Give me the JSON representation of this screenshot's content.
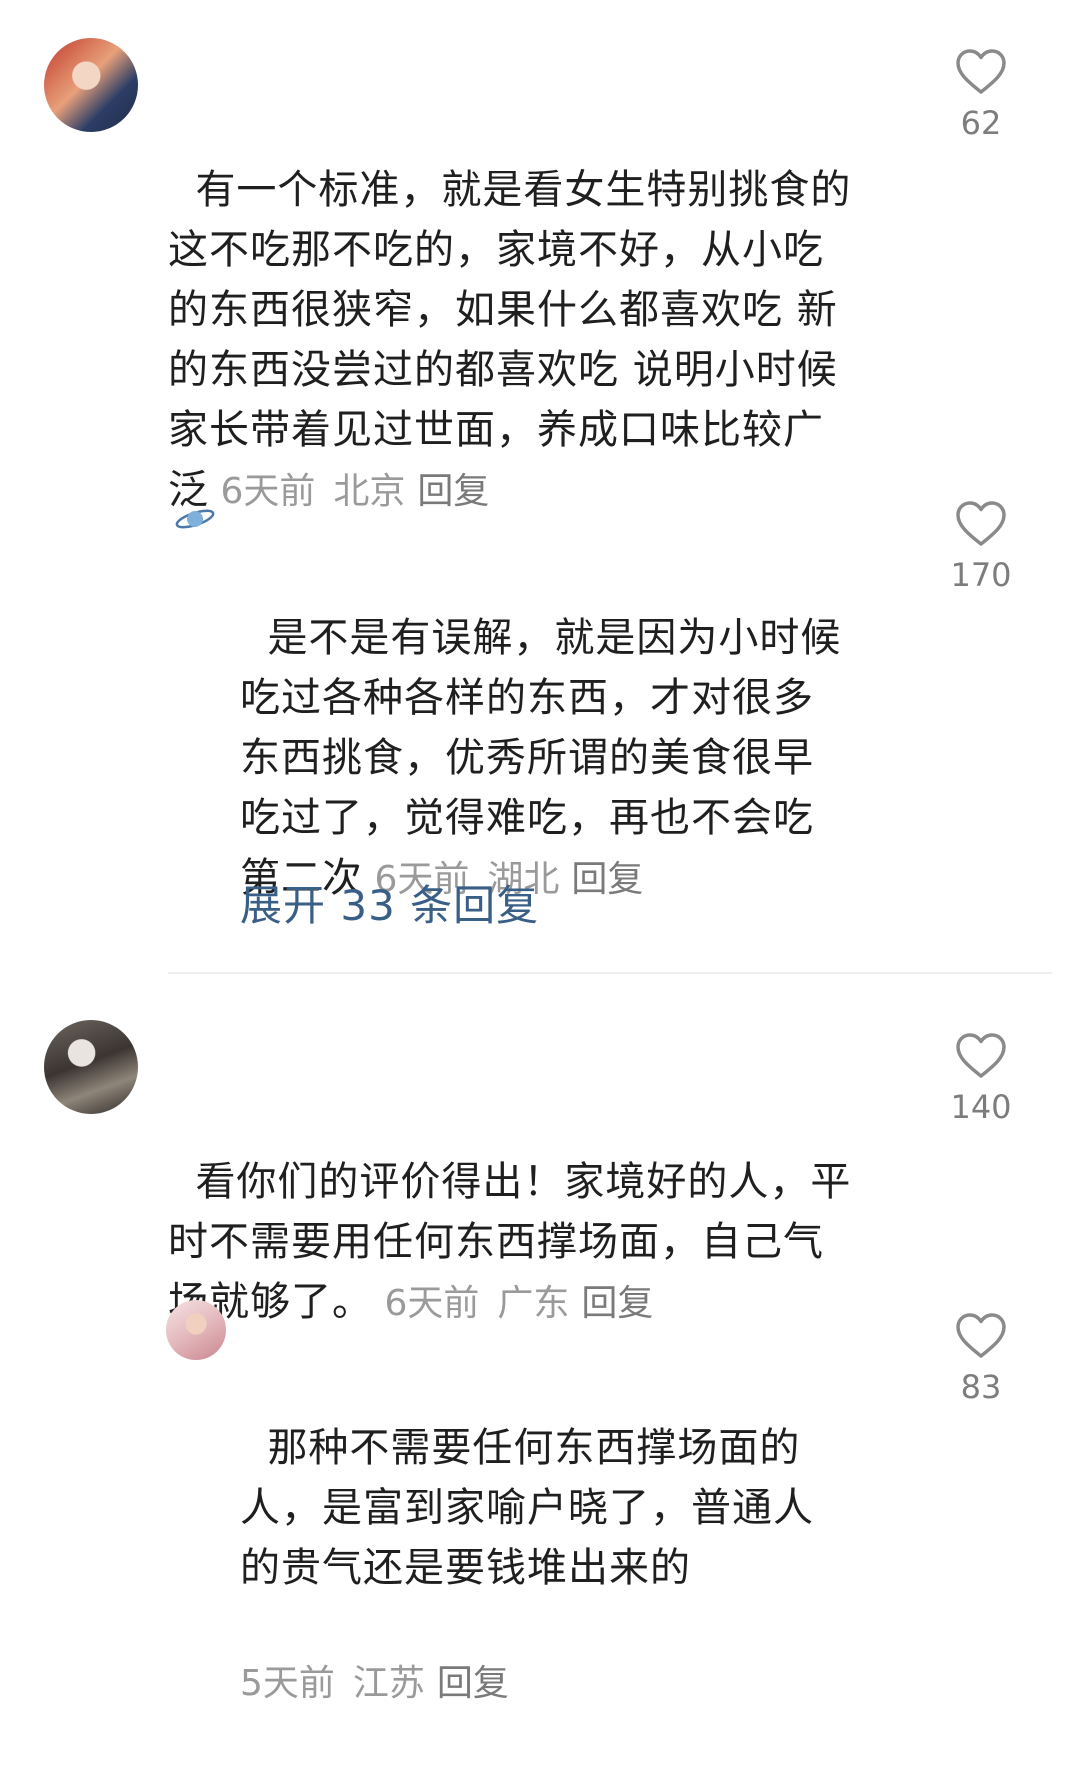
{
  "comments": [
    {
      "text": "有一个标准，就是看女生特别挑食的\n这不吃那不吃的，家境不好，从小吃\n的东西很狭窄，如果什么都喜欢吃 新\n的东西没尝过的都喜欢吃 说明小时候\n家长带着见过世面，养成口味比较广\n泛",
      "time": "6天前",
      "location": "北京",
      "reply_label": "回复",
      "likes": "62"
    },
    {
      "text": "是不是有误解，就是因为小时候\n吃过各种各样的东西，才对很多\n东西挑食，优秀所谓的美食很早\n吃过了，觉得难吃，再也不会吃\n第二次",
      "time": "6天前",
      "location": "湖北",
      "reply_label": "回复",
      "likes": "170"
    },
    {
      "text": "看你们的评价得出！家境好的人，平\n时不需要用任何东西撑场面，自己气\n场就够了。",
      "time": "6天前",
      "location": "广东",
      "reply_label": "回复",
      "likes": "140"
    },
    {
      "text": "那种不需要任何东西撑场面的\n人，是富到家喻户晓了，普通人\n的贵气还是要钱堆出来的",
      "time": "5天前",
      "location": "江苏",
      "reply_label": "回复",
      "likes": "83"
    }
  ],
  "expand_replies": "展开 33 条回复",
  "colors": {
    "link": "#3a5f87",
    "meta": "#9a9a9a",
    "text": "#1f1f1f"
  },
  "icons": [
    "heart-outline-icon",
    "planet-icon"
  ]
}
